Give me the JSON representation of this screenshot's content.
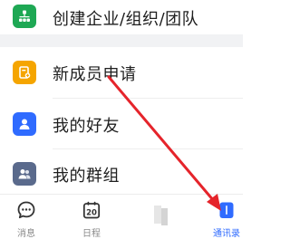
{
  "list": {
    "items": [
      {
        "label": "创建企业/组织/团队",
        "icon": "org-tree-icon",
        "color": "#1ea854"
      },
      {
        "label": "新成员申请",
        "icon": "new-member-icon",
        "color": "#f5a500"
      },
      {
        "label": "我的好友",
        "icon": "person-icon",
        "color": "#2f6bff"
      },
      {
        "label": "我的群组",
        "icon": "group-icon",
        "color": "#5a6a8c"
      }
    ]
  },
  "tabbar": {
    "tabs": [
      {
        "label": "消息",
        "icon": "message-icon",
        "active": false
      },
      {
        "label": "日程",
        "icon": "calendar-icon",
        "active": false,
        "day": "20"
      },
      {
        "label": "",
        "icon": "workspace-icon",
        "active": false
      },
      {
        "label": "通讯录",
        "icon": "contacts-icon",
        "active": true
      }
    ]
  },
  "colors": {
    "accent": "#2f6bff",
    "arrow": "#e5242b"
  }
}
